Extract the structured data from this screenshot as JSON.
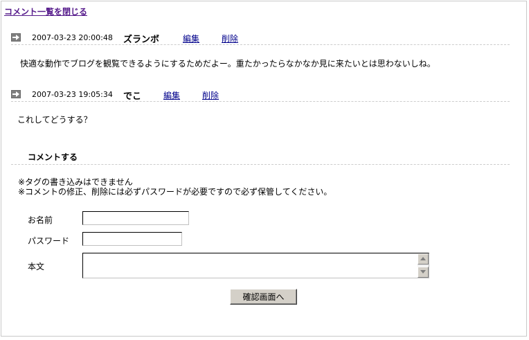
{
  "close_link": "コメント一覧を閉じる",
  "comments": [
    {
      "date": "2007-03-23 20:00:48",
      "author": "ズランボ",
      "edit_label": "編集",
      "delete_label": "削除",
      "body": "快適な動作でブログを観覧できるようにするためだよー。重たかったらなかなか見に来たいとは思わないしね。"
    },
    {
      "date": "2007-03-23 19:05:34",
      "author": "でこ",
      "edit_label": "編集",
      "delete_label": "削除",
      "body": "これしてどうする？"
    }
  ],
  "comment_form": {
    "title": "コメントする",
    "note1": "※タグの書き込みはできません",
    "note2": "※コメントの修正、削除には必ずパスワードが必要ですので必ず保管してください。",
    "name_label": "お名前",
    "name_value": "",
    "password_label": "パスワード",
    "password_value": "",
    "body_label": "本文",
    "body_value": "",
    "submit_label": "確認画面へ"
  }
}
